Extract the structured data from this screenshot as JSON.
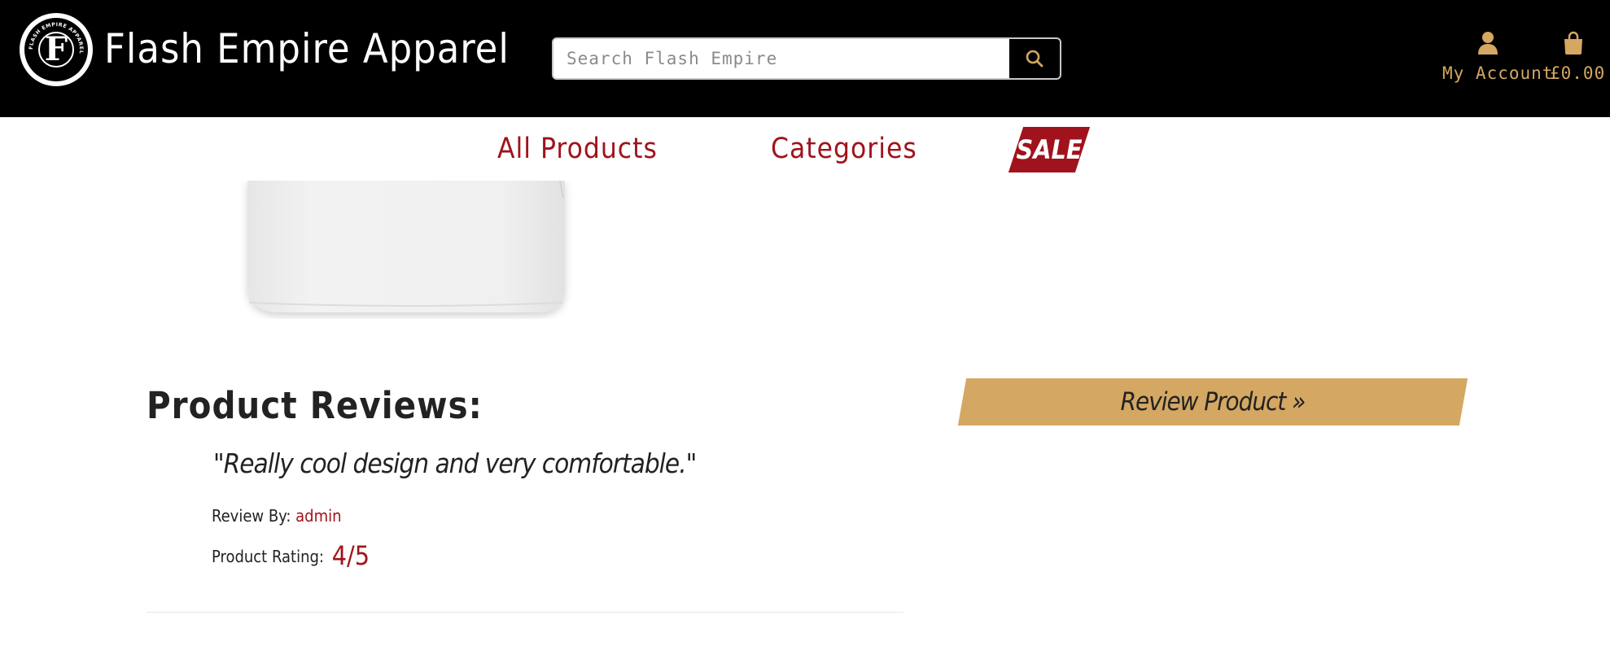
{
  "header": {
    "logo_icon": "flash-empire-seal-logo",
    "logo_text": "FLASH EMPIRE APPAREL",
    "logo_letter": "F",
    "brand_name": "Flash Empire Apparel",
    "search": {
      "placeholder": "Search Flash Empire",
      "value": "",
      "button_icon": "search-icon"
    },
    "account": {
      "icon": "user-icon",
      "label": "My Account"
    },
    "cart": {
      "icon": "shopping-bag-icon",
      "label": "£0.00"
    }
  },
  "nav": {
    "items": [
      {
        "label": "All Products"
      },
      {
        "label": "Categories"
      },
      {
        "label": "SALE"
      }
    ]
  },
  "product": {
    "image": "white-tshirt-product-image"
  },
  "reviews": {
    "title": "Product Reviews:",
    "items": [
      {
        "quote": "\"Really cool design and very comfortable.\"",
        "by_label": "Review By:",
        "author": "admin",
        "rating_label": "Product Rating:",
        "rating": "4/5"
      }
    ],
    "review_button_label": "Review Product »"
  },
  "colors": {
    "header_bg": "#000000",
    "accent_red": "#a0131c",
    "accent_gold": "#d4a762",
    "text_dark": "#222222"
  }
}
